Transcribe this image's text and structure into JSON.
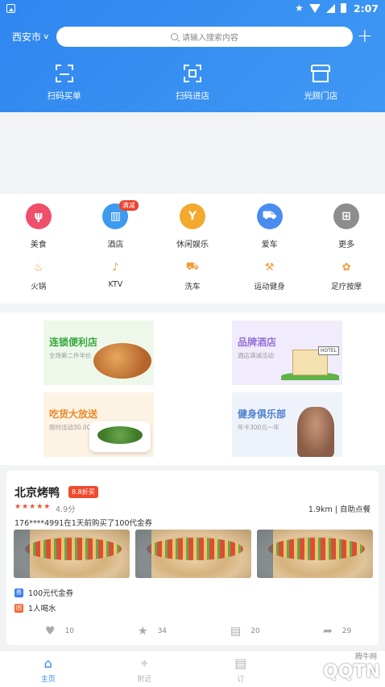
{
  "status": {
    "time": "2:07"
  },
  "header": {
    "city": "西安市",
    "search_placeholder": "请输入搜索内容",
    "quick": [
      {
        "label": "扫码买单",
        "icon": "scan-pay-icon"
      },
      {
        "label": "扫码进店",
        "icon": "scan-enter-icon"
      },
      {
        "label": "光顾门店",
        "icon": "store-icon"
      }
    ]
  },
  "categories": {
    "main": [
      {
        "label": "美食",
        "color": "#ef4f6b",
        "icon": "fork-knife-icon",
        "glyph": "ψ"
      },
      {
        "label": "酒店",
        "color": "#3d9bef",
        "icon": "hotel-building-icon",
        "glyph": "▥",
        "badge": "满减"
      },
      {
        "label": "休闲娱乐",
        "color": "#f3a92e",
        "icon": "cocktail-icon",
        "glyph": "Y"
      },
      {
        "label": "爱车",
        "color": "#4a8cf0",
        "icon": "car-icon",
        "glyph": "⛟"
      },
      {
        "label": "更多",
        "color": "#8d8d8d",
        "icon": "grid-icon",
        "glyph": "⊞"
      }
    ],
    "sub": [
      {
        "label": "火锅",
        "icon": "hotpot-icon",
        "glyph": "♨"
      },
      {
        "label": "KTV",
        "icon": "microphone-icon",
        "glyph": "♪"
      },
      {
        "label": "洗车",
        "icon": "car-wash-icon",
        "glyph": "⛟"
      },
      {
        "label": "运动健身",
        "icon": "dumbbell-icon",
        "glyph": "⚒"
      },
      {
        "label": "足疗按摩",
        "icon": "foot-icon",
        "glyph": "✿"
      }
    ]
  },
  "promos": [
    {
      "title": "连锁便利店",
      "sub": "全场第二件半价"
    },
    {
      "title": "品牌酒店",
      "sub": "酒店满减活动",
      "sign": "HOTEL"
    },
    {
      "title": "吃货大放送",
      "sub": "限时活动30.00"
    },
    {
      "title": "健身俱乐部",
      "sub": "年卡300元一年"
    }
  ],
  "shop": {
    "name": "北京烤鸭",
    "discount": "8.8折买",
    "rating": 4.9,
    "score": "4.9分",
    "distance": "1.9km | 自助点餐",
    "news": "176****4991在1天前购买了100代金券",
    "deals": [
      {
        "icon": "voucher-icon",
        "glyph": "券",
        "text": "100元代金券"
      },
      {
        "icon": "group-icon",
        "glyph": "团",
        "text": "1人喝水"
      }
    ],
    "actions": [
      {
        "icon": "heart-icon",
        "glyph": "♥",
        "count": "10"
      },
      {
        "icon": "star-icon",
        "glyph": "★",
        "count": "34"
      },
      {
        "icon": "comment-icon",
        "glyph": "▤",
        "count": "20"
      },
      {
        "icon": "share-icon",
        "glyph": "➦",
        "count": "29"
      }
    ]
  },
  "nav": [
    {
      "label": "主页",
      "icon": "home-icon",
      "glyph": "⌂",
      "active": true
    },
    {
      "label": "附近",
      "icon": "location-icon",
      "glyph": "⌖",
      "active": false
    },
    {
      "label": "订",
      "icon": "order-icon",
      "glyph": "▤",
      "active": false
    },
    {
      "label": "",
      "icon": "user-icon",
      "glyph": "",
      "active": false
    }
  ],
  "watermark": {
    "logo": "QQTN",
    "small": "腾牛网"
  }
}
